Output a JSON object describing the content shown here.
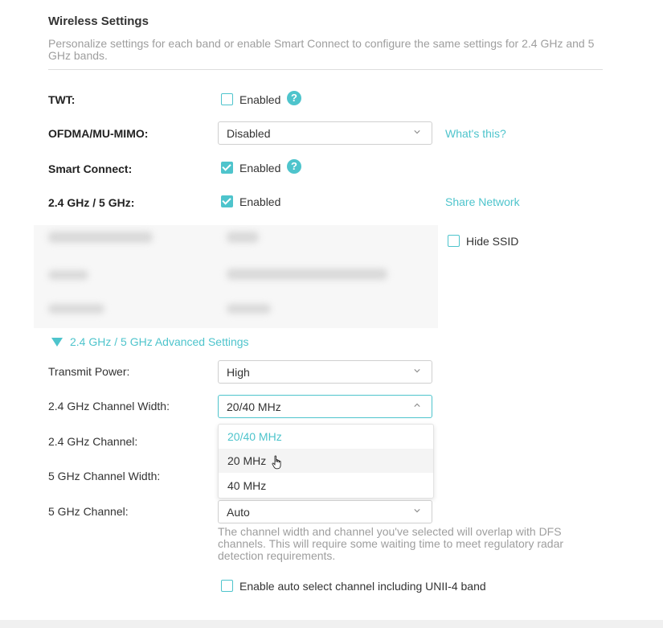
{
  "section": {
    "title": "Wireless Settings",
    "description": "Personalize settings for each band or enable Smart Connect to configure the same settings for 2.4 GHz and 5 GHz bands."
  },
  "twt": {
    "label": "TWT:",
    "checkbox_label": "Enabled",
    "checked": false
  },
  "ofdma": {
    "label": "OFDMA/MU-MIMO:",
    "value": "Disabled",
    "link": "What's this?"
  },
  "smart_connect": {
    "label": "Smart Connect:",
    "checkbox_label": "Enabled",
    "checked": true
  },
  "band": {
    "label": "2.4 GHz / 5 GHz:",
    "checkbox_label": "Enabled",
    "checked": true,
    "link": "Share Network"
  },
  "hide_ssid": {
    "label": "Hide SSID",
    "checked": false
  },
  "advanced": {
    "toggle_label": "2.4 GHz / 5 GHz Advanced Settings"
  },
  "transmit_power": {
    "label": "Transmit Power:",
    "value": "High"
  },
  "channel_width_24": {
    "label": "2.4 GHz Channel Width:",
    "value": "20/40 MHz",
    "options": [
      "20/40 MHz",
      "20 MHz",
      "40 MHz"
    ]
  },
  "channel_24": {
    "label": "2.4 GHz Channel:"
  },
  "channel_width_5": {
    "label": "5 GHz Channel Width:"
  },
  "channel_5": {
    "label": "5 GHz Channel:",
    "value": "Auto"
  },
  "dfs_note": "The channel width and channel you've selected will overlap with DFS channels. This will require some waiting time to meet regulatory radar detection requirements.",
  "unii4": {
    "label": "Enable auto select channel including UNII-4 band",
    "checked": false
  },
  "colors": {
    "accent": "#4ec4cc",
    "muted_text": "#9e9e9e",
    "border": "#cfcfcf"
  }
}
